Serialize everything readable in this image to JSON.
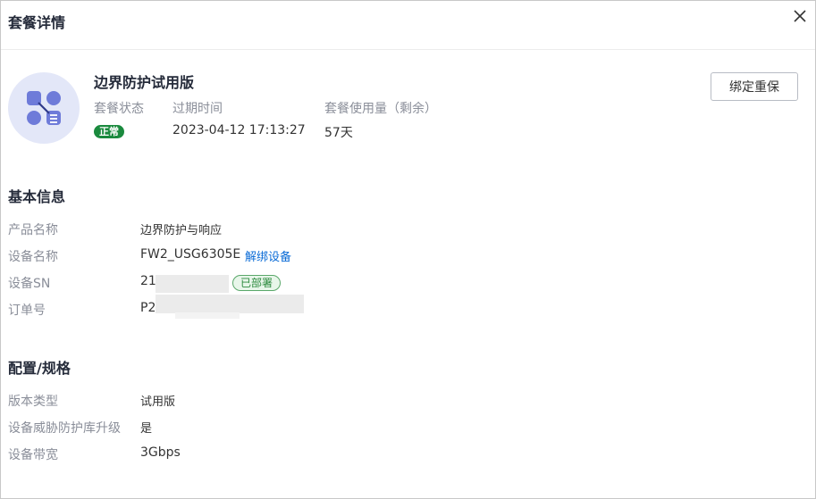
{
  "dialog": {
    "title": "套餐详情",
    "close_label": "✕"
  },
  "package": {
    "name": "边界防护试用版",
    "status_label": "套餐状态",
    "status_value": "正常",
    "expire_label": "过期时间",
    "expire_value": "2023-04-12 17:13:27",
    "usage_label": "套餐使用量（剩余）",
    "usage_value": "57天",
    "bind_button": "绑定重保",
    "icon": "package-apps-icon"
  },
  "basic_info": {
    "title": "基本信息",
    "product_name_label": "产品名称",
    "product_name_value": "边界防护与响应",
    "device_name_label": "设备名称",
    "device_name_value": "FW2_USG6305E",
    "unbind_link": "解绑设备",
    "device_sn_label": "设备SN",
    "device_sn_value": "21",
    "deployed_badge": "已部署",
    "order_label": "订单号",
    "order_value": "P2"
  },
  "config": {
    "title": "配置/规格",
    "version_type_label": "版本类型",
    "version_type_value": "试用版",
    "threat_db_label": "设备威胁防护库升级",
    "threat_db_value": "是",
    "bandwidth_label": "设备带宽",
    "bandwidth_value": "3Gbps"
  },
  "colors": {
    "accent_link": "#0a6bd6",
    "status_green": "#1a8a3e",
    "icon_bg": "#e3e7f8",
    "icon_fg": "#6e7bd9"
  }
}
